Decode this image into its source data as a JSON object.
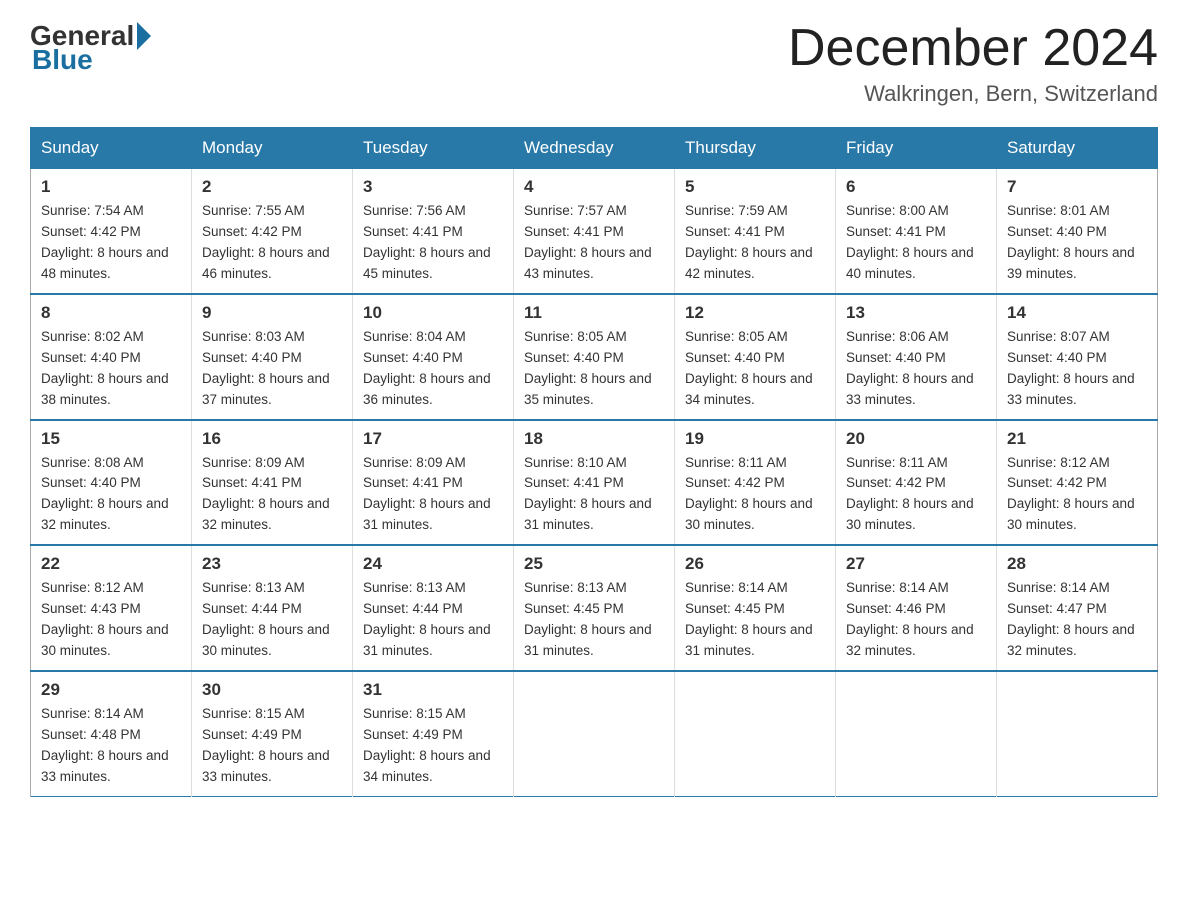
{
  "header": {
    "logo_general": "General",
    "logo_blue": "Blue",
    "month_title": "December 2024",
    "location": "Walkringen, Bern, Switzerland"
  },
  "days_of_week": [
    "Sunday",
    "Monday",
    "Tuesday",
    "Wednesday",
    "Thursday",
    "Friday",
    "Saturday"
  ],
  "weeks": [
    [
      {
        "day": "1",
        "sunrise": "7:54 AM",
        "sunset": "4:42 PM",
        "daylight": "8 hours and 48 minutes."
      },
      {
        "day": "2",
        "sunrise": "7:55 AM",
        "sunset": "4:42 PM",
        "daylight": "8 hours and 46 minutes."
      },
      {
        "day": "3",
        "sunrise": "7:56 AM",
        "sunset": "4:41 PM",
        "daylight": "8 hours and 45 minutes."
      },
      {
        "day": "4",
        "sunrise": "7:57 AM",
        "sunset": "4:41 PM",
        "daylight": "8 hours and 43 minutes."
      },
      {
        "day": "5",
        "sunrise": "7:59 AM",
        "sunset": "4:41 PM",
        "daylight": "8 hours and 42 minutes."
      },
      {
        "day": "6",
        "sunrise": "8:00 AM",
        "sunset": "4:41 PM",
        "daylight": "8 hours and 40 minutes."
      },
      {
        "day": "7",
        "sunrise": "8:01 AM",
        "sunset": "4:40 PM",
        "daylight": "8 hours and 39 minutes."
      }
    ],
    [
      {
        "day": "8",
        "sunrise": "8:02 AM",
        "sunset": "4:40 PM",
        "daylight": "8 hours and 38 minutes."
      },
      {
        "day": "9",
        "sunrise": "8:03 AM",
        "sunset": "4:40 PM",
        "daylight": "8 hours and 37 minutes."
      },
      {
        "day": "10",
        "sunrise": "8:04 AM",
        "sunset": "4:40 PM",
        "daylight": "8 hours and 36 minutes."
      },
      {
        "day": "11",
        "sunrise": "8:05 AM",
        "sunset": "4:40 PM",
        "daylight": "8 hours and 35 minutes."
      },
      {
        "day": "12",
        "sunrise": "8:05 AM",
        "sunset": "4:40 PM",
        "daylight": "8 hours and 34 minutes."
      },
      {
        "day": "13",
        "sunrise": "8:06 AM",
        "sunset": "4:40 PM",
        "daylight": "8 hours and 33 minutes."
      },
      {
        "day": "14",
        "sunrise": "8:07 AM",
        "sunset": "4:40 PM",
        "daylight": "8 hours and 33 minutes."
      }
    ],
    [
      {
        "day": "15",
        "sunrise": "8:08 AM",
        "sunset": "4:40 PM",
        "daylight": "8 hours and 32 minutes."
      },
      {
        "day": "16",
        "sunrise": "8:09 AM",
        "sunset": "4:41 PM",
        "daylight": "8 hours and 32 minutes."
      },
      {
        "day": "17",
        "sunrise": "8:09 AM",
        "sunset": "4:41 PM",
        "daylight": "8 hours and 31 minutes."
      },
      {
        "day": "18",
        "sunrise": "8:10 AM",
        "sunset": "4:41 PM",
        "daylight": "8 hours and 31 minutes."
      },
      {
        "day": "19",
        "sunrise": "8:11 AM",
        "sunset": "4:42 PM",
        "daylight": "8 hours and 30 minutes."
      },
      {
        "day": "20",
        "sunrise": "8:11 AM",
        "sunset": "4:42 PM",
        "daylight": "8 hours and 30 minutes."
      },
      {
        "day": "21",
        "sunrise": "8:12 AM",
        "sunset": "4:42 PM",
        "daylight": "8 hours and 30 minutes."
      }
    ],
    [
      {
        "day": "22",
        "sunrise": "8:12 AM",
        "sunset": "4:43 PM",
        "daylight": "8 hours and 30 minutes."
      },
      {
        "day": "23",
        "sunrise": "8:13 AM",
        "sunset": "4:44 PM",
        "daylight": "8 hours and 30 minutes."
      },
      {
        "day": "24",
        "sunrise": "8:13 AM",
        "sunset": "4:44 PM",
        "daylight": "8 hours and 31 minutes."
      },
      {
        "day": "25",
        "sunrise": "8:13 AM",
        "sunset": "4:45 PM",
        "daylight": "8 hours and 31 minutes."
      },
      {
        "day": "26",
        "sunrise": "8:14 AM",
        "sunset": "4:45 PM",
        "daylight": "8 hours and 31 minutes."
      },
      {
        "day": "27",
        "sunrise": "8:14 AM",
        "sunset": "4:46 PM",
        "daylight": "8 hours and 32 minutes."
      },
      {
        "day": "28",
        "sunrise": "8:14 AM",
        "sunset": "4:47 PM",
        "daylight": "8 hours and 32 minutes."
      }
    ],
    [
      {
        "day": "29",
        "sunrise": "8:14 AM",
        "sunset": "4:48 PM",
        "daylight": "8 hours and 33 minutes."
      },
      {
        "day": "30",
        "sunrise": "8:15 AM",
        "sunset": "4:49 PM",
        "daylight": "8 hours and 33 minutes."
      },
      {
        "day": "31",
        "sunrise": "8:15 AM",
        "sunset": "4:49 PM",
        "daylight": "8 hours and 34 minutes."
      },
      null,
      null,
      null,
      null
    ]
  ]
}
